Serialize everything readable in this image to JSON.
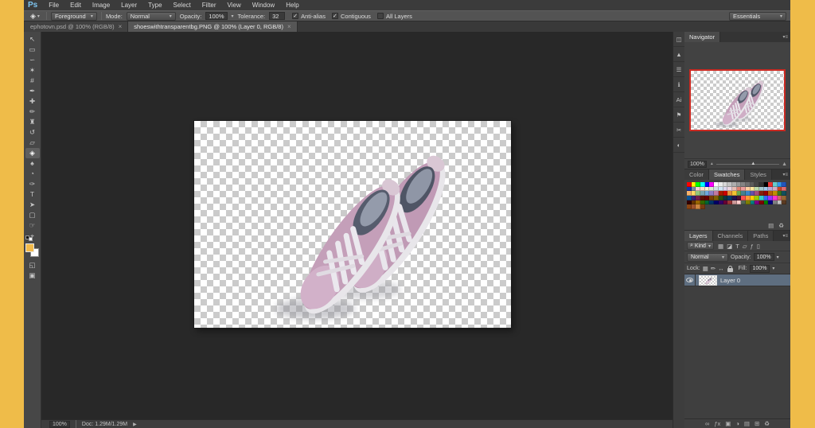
{
  "menubar": {
    "logo": "Ps",
    "items": [
      "File",
      "Edit",
      "Image",
      "Layer",
      "Type",
      "Select",
      "Filter",
      "View",
      "Window",
      "Help"
    ]
  },
  "options": {
    "tool_glyph": "◈",
    "caret": "▾",
    "preset_value": "Foreground",
    "mode_label": "Mode:",
    "mode_value": "Normal",
    "opacity_label": "Opacity:",
    "opacity_value": "100%",
    "tolerance_label": "Tolerance:",
    "tolerance_value": "32",
    "checkboxes": [
      {
        "label": "Anti-alias",
        "mark": "✓"
      },
      {
        "label": "Contiguous",
        "mark": "✓"
      },
      {
        "label": "All Layers",
        "mark": ""
      }
    ],
    "workspace_value": "Essentials"
  },
  "doc_tabs": [
    {
      "label": "ephotovn.psd @ 100% (RGB/8)",
      "close": "×",
      "cls": ""
    },
    {
      "label": "shoeswithtransparentbg.PNG @ 100% (Layer 0, RGB/8)",
      "close": "×",
      "cls": "selected_active"
    }
  ],
  "tools": [
    {
      "g": "↖",
      "n": "move-tool",
      "cls": ""
    },
    {
      "g": "▭",
      "n": "marquee-tool",
      "cls": ""
    },
    {
      "g": "∽",
      "n": "lasso-tool",
      "cls": ""
    },
    {
      "g": "✶",
      "n": "magic-wand-tool",
      "cls": ""
    },
    {
      "g": "#",
      "n": "crop-tool",
      "cls": ""
    },
    {
      "g": "✒",
      "n": "eyedropper-tool",
      "cls": ""
    },
    {
      "g": "✚",
      "n": "healing-brush-tool",
      "cls": ""
    },
    {
      "g": "✏",
      "n": "brush-tool",
      "cls": ""
    },
    {
      "g": "♜",
      "n": "clone-stamp-tool",
      "cls": ""
    },
    {
      "g": "↺",
      "n": "history-brush-tool",
      "cls": ""
    },
    {
      "g": "▱",
      "n": "eraser-tool",
      "cls": ""
    },
    {
      "g": "◈",
      "n": "paint-bucket-tool",
      "cls": "selected_active"
    },
    {
      "g": "♠",
      "n": "blur-tool",
      "cls": ""
    },
    {
      "g": "◔",
      "n": "dodge-tool",
      "cls": ""
    },
    {
      "g": "✑",
      "n": "pen-tool",
      "cls": ""
    },
    {
      "g": "T",
      "n": "type-tool",
      "cls": ""
    },
    {
      "g": "➤",
      "n": "path-selection-tool",
      "cls": ""
    },
    {
      "g": "▢",
      "n": "shape-tool",
      "cls": ""
    },
    {
      "g": "☞",
      "n": "hand-tool",
      "cls": ""
    },
    {
      "g": "⌖",
      "n": "zoom-tool",
      "cls": ""
    }
  ],
  "toolbar_extra": [
    {
      "g": "◱",
      "n": "quick-mask-button"
    },
    {
      "g": "▣",
      "n": "screen-mode-button"
    }
  ],
  "colors": {
    "foreground": "#F2BA4B",
    "background_swatch": "#FFFFFF",
    "border": "#EFBC49",
    "accent_red": "#CC2A22"
  },
  "dock_icons": [
    {
      "g": "◫",
      "n": "dock-panel-icon-1"
    },
    {
      "g": "▲",
      "n": "dock-panel-icon-2"
    },
    {
      "g": "☰",
      "n": "dock-panel-icon-3"
    },
    {
      "g": "ℹ",
      "n": "dock-panel-icon-4"
    },
    {
      "g": "Ai",
      "n": "dock-panel-icon-5"
    },
    {
      "g": "⚑",
      "n": "dock-panel-icon-6"
    },
    {
      "g": "✂",
      "n": "dock-panel-icon-7"
    },
    {
      "g": "◐",
      "n": "dock-panel-icon-8"
    }
  ],
  "navigator": {
    "title": "Navigator",
    "zoom": "100%",
    "panel_menu": "▾≡",
    "slider_thumb": "▲",
    "mountain_small": "▲",
    "mountain_large": "▲"
  },
  "swatch_panel": {
    "tabs": [
      {
        "label": "Color",
        "cls": ""
      },
      {
        "label": "Swatches",
        "cls": "selected_active"
      },
      {
        "label": "Styles",
        "cls": ""
      }
    ],
    "icons": [
      {
        "g": "▤",
        "n": "new-swatch-button"
      },
      {
        "g": "♻",
        "n": "delete-swatch-button"
      }
    ],
    "colors": [
      "#ff0000",
      "#ffff00",
      "#00ff00",
      "#00ffff",
      "#0000ff",
      "#ff00ff",
      "#ffffff",
      "#ebebeb",
      "#d7d7d7",
      "#c2c2c2",
      "#aeaeae",
      "#999999",
      "#848484",
      "#6f6f6f",
      "#5b5b5b",
      "#464646",
      "#323232",
      "#000000",
      "#ee3333",
      "#66cccc",
      "#3399ee",
      "#2255bb",
      "#1133aa",
      "#7788aa",
      "#f6cfcf",
      "#f9dfc9",
      "#fdf3cd",
      "#dcecd5",
      "#d2e2e6",
      "#d1e4f5",
      "#dcd5ec",
      "#ecd5e0",
      "#e8bcb3",
      "#e08272",
      "#ec9d9d",
      "#fbce9f",
      "#ffe89d",
      "#badaab",
      "#a6c8cd",
      "#a3c9ec",
      "#b8abd9",
      "#d9aac1",
      "#cc4528",
      "#e26a6a",
      "#f6b26b",
      "#ffd966",
      "#93c47d",
      "#76a5af",
      "#6fa8dc",
      "#8e7cc3",
      "#c27ba0",
      "#a61c00",
      "#cc0000",
      "#e69138",
      "#f1c232",
      "#6aa84f",
      "#45818e",
      "#3d85c6",
      "#674ea7",
      "#a64d79",
      "#85200c",
      "#990000",
      "#b45f06",
      "#bf9000",
      "#38761d",
      "#134f5c",
      "#0b5394",
      "#351c75",
      "#741b47",
      "#5b0f00",
      "#660000",
      "#783f04",
      "#7f6000",
      "#274e13",
      "#0c343d",
      "#073763",
      "#20124d",
      "#4c1130",
      "#ff5050",
      "#ff9933",
      "#ffcc00",
      "#99cc00",
      "#33cccc",
      "#3366ff",
      "#9933ff",
      "#ff33cc",
      "#cc6666",
      "#996633",
      "#330000",
      "#663300",
      "#996600",
      "#336600",
      "#006633",
      "#003366",
      "#000066",
      "#330066",
      "#660033",
      "#993333",
      "#cc9999",
      "#ffcccc",
      "#556655",
      "#808000",
      "#008080",
      "#800080",
      "#800000",
      "#008000",
      "#000080",
      "#808080",
      "#c0c0c0",
      "#5a3a22",
      "#8b4513",
      "#a0522d",
      "#cd853f",
      "#7a3b10"
    ]
  },
  "layers_panel": {
    "tabs": [
      {
        "label": "Layers",
        "cls": "selected_active"
      },
      {
        "label": "Channels",
        "cls": ""
      },
      {
        "label": "Paths",
        "cls": ""
      }
    ],
    "panel_menu": "▾≡",
    "filter_label": "Kind",
    "filter_search_glyph": "⌕",
    "filter_icons": [
      {
        "g": "▦",
        "n": "filter-pixel-layers-icon"
      },
      {
        "g": "◪",
        "n": "filter-adjustment-layers-icon"
      },
      {
        "g": "T",
        "n": "filter-type-layers-icon"
      },
      {
        "g": "▱",
        "n": "filter-group-layers-icon"
      },
      {
        "g": "ƒ",
        "n": "filter-effect-layers-icon"
      },
      {
        "g": "▯",
        "n": "filter-toggle-icon"
      }
    ],
    "blend_mode": "Normal",
    "opacity_label": "Opacity:",
    "opacity_value": "100%",
    "lock_label": "Lock:",
    "lock_icons": [
      {
        "g": "▦",
        "n": "lock-transparent-pixels-icon"
      },
      {
        "g": "✏",
        "n": "lock-image-pixels-icon"
      },
      {
        "g": "↔",
        "n": "lock-position-icon"
      }
    ],
    "fill_label": "Fill:",
    "fill_value": "100%",
    "layers": [
      {
        "name": "Layer 0",
        "cls": "selected_active"
      }
    ],
    "bottom_icons": [
      {
        "g": "∞",
        "n": "link-layers-button"
      },
      {
        "g": "ƒx",
        "n": "layer-style-button"
      },
      {
        "g": "▣",
        "n": "add-layer-mask-button"
      },
      {
        "g": "◑",
        "n": "adjustment-layer-button"
      },
      {
        "g": "▤",
        "n": "new-group-button"
      },
      {
        "g": "⊞",
        "n": "new-layer-button"
      },
      {
        "g": "♻",
        "n": "delete-layer-button"
      }
    ]
  },
  "statusbar": {
    "zoom": "100%",
    "doc": "Doc: 1.29M/1.29M",
    "arrow": "▶"
  }
}
